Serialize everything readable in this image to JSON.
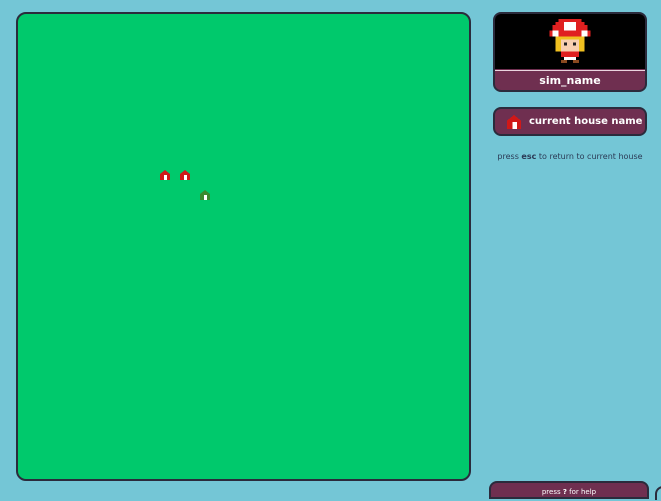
{
  "map": {
    "houses": [
      {
        "name": "house-marker",
        "color": "red"
      },
      {
        "name": "house-marker",
        "color": "red"
      },
      {
        "name": "house-marker",
        "color": "green"
      }
    ]
  },
  "profile": {
    "sim_name": "sim_name",
    "avatar_icon": "mushroom-character-icon"
  },
  "house_button": {
    "label": "current house name",
    "icon": "house-icon"
  },
  "hint": {
    "prefix": "press ",
    "key": "esc",
    "suffix": " to return to current house"
  },
  "help": {
    "prefix": "press ",
    "key": "?",
    "suffix": " for help"
  },
  "colors": {
    "background": "#74c6d6",
    "map_green": "#00c96c",
    "panel": "#6f2f50",
    "border": "#2b2b3c"
  }
}
